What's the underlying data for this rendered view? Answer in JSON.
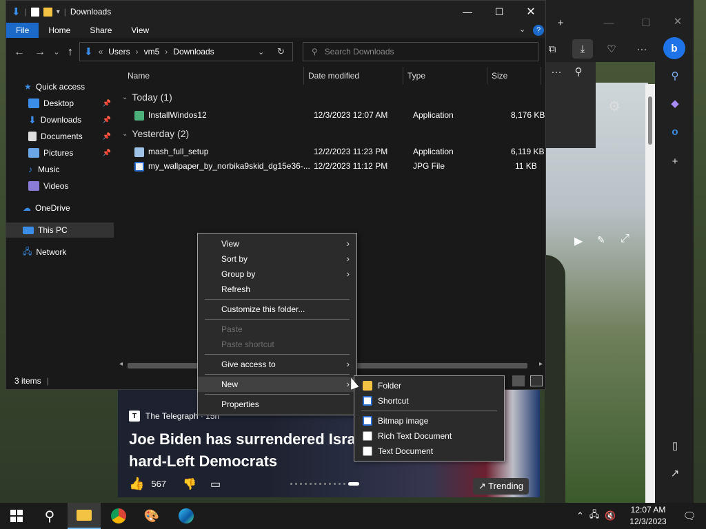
{
  "explorer": {
    "title": "Downloads",
    "ribbon_tabs": [
      "File",
      "Home",
      "Share",
      "View"
    ],
    "breadcrumb": [
      "Users",
      "vm5",
      "Downloads"
    ],
    "breadcrumb_prefix": "«",
    "search_placeholder": "Search Downloads",
    "columns": [
      "Name",
      "Date modified",
      "Type",
      "Size"
    ],
    "nav_pane": {
      "quick_access": "Quick access",
      "items": [
        "Desktop",
        "Downloads",
        "Documents",
        "Pictures",
        "Music",
        "Videos"
      ],
      "onedrive": "OneDrive",
      "this_pc": "This PC",
      "network": "Network"
    },
    "groups": [
      {
        "label": "Today (1)",
        "files": [
          {
            "name": "InstallWindos12",
            "date": "12/3/2023 12:07 AM",
            "type": "Application",
            "size": "8,176 KB"
          }
        ]
      },
      {
        "label": "Yesterday (2)",
        "files": [
          {
            "name": "mash_full_setup",
            "date": "12/2/2023 11:23 PM",
            "type": "Application",
            "size": "6,119 KB"
          },
          {
            "name": "my_wallpaper_by_norbika9skid_dg15e36-...",
            "date": "12/2/2023 11:12 PM",
            "type": "JPG File",
            "size": "11 KB"
          }
        ]
      }
    ],
    "status": "3 items"
  },
  "context_menu": {
    "items": {
      "view": "View",
      "sort_by": "Sort by",
      "group_by": "Group by",
      "refresh": "Refresh",
      "customize": "Customize this folder...",
      "paste": "Paste",
      "paste_shortcut": "Paste shortcut",
      "give_access": "Give access to",
      "new": "New",
      "properties": "Properties"
    }
  },
  "submenu_new": {
    "folder": "Folder",
    "shortcut": "Shortcut",
    "bitmap": "Bitmap image",
    "rtf": "Rich Text Document",
    "text": "Text Document"
  },
  "news": {
    "source": "The Telegraph · 15h",
    "headline": "Joe Biden has surrendered Isra hard-Left Democrats",
    "headline_line1": "Joe Biden has surrendered Isra",
    "headline_line2": "hard-Left Democrats",
    "likes": "567",
    "trending": "Trending"
  },
  "taskbar": {
    "time": "12:07 AM",
    "date": "12/3/2023"
  },
  "colors": {
    "accent": "#1b6ac9",
    "folder": "#f3c444",
    "menu_bg": "#2b2b2b"
  }
}
